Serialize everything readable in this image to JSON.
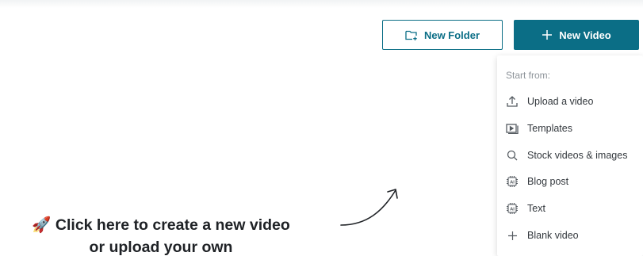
{
  "toolbar": {
    "new_folder_label": "New Folder",
    "new_video_label": "New Video",
    "accent_color": "#0b6e86"
  },
  "menu": {
    "heading": "Start from:",
    "items": [
      {
        "label": "Upload a video",
        "icon": "upload-icon"
      },
      {
        "label": "Templates",
        "icon": "template-icon"
      },
      {
        "label": "Stock videos & images",
        "icon": "search-icon"
      },
      {
        "label": "Blog post",
        "icon": "ai-chip-icon"
      },
      {
        "label": "Text",
        "icon": "ai-chip-icon"
      },
      {
        "label": "Blank video",
        "icon": "plus-icon"
      }
    ]
  },
  "hint": {
    "emoji": "🚀",
    "line1": "Click here to create a new video",
    "line2": "or upload your own"
  }
}
